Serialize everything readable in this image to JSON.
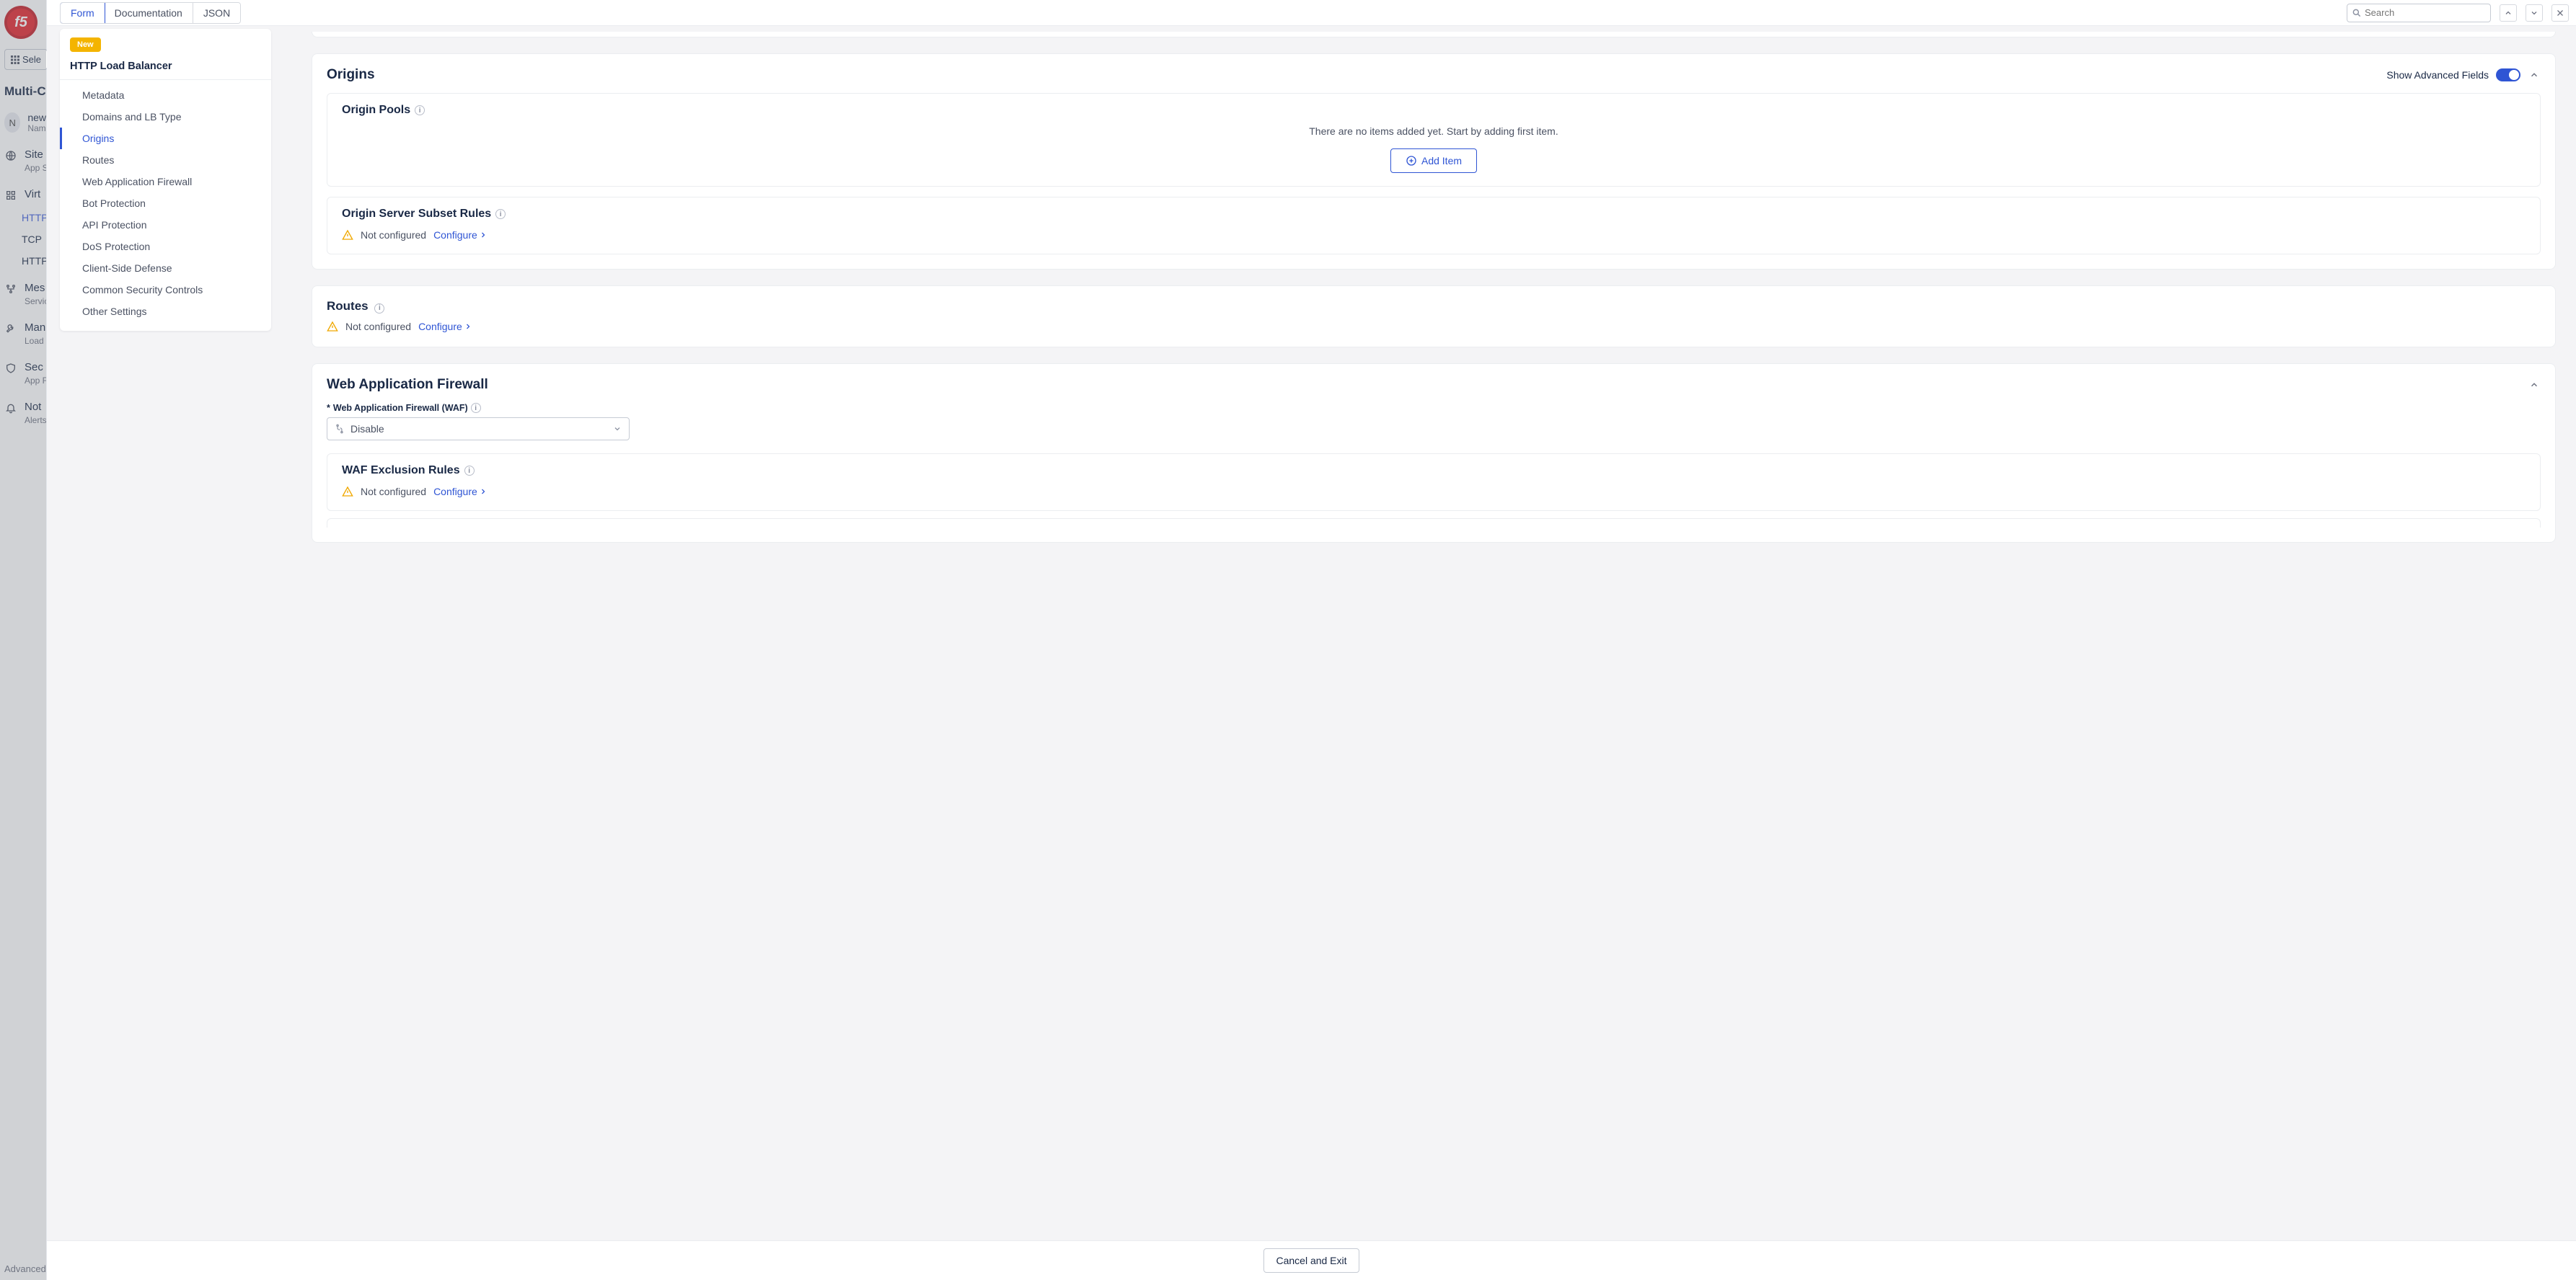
{
  "brand_logo_text": "f5",
  "bg": {
    "select_label": "Sele",
    "title": "Multi-C",
    "avatar_letter": "N",
    "avatar_name": "new",
    "avatar_sub": "Nam",
    "sites": {
      "label": "Site",
      "sub": "App S"
    },
    "virtual": {
      "label": "Virt"
    },
    "sublinks": {
      "http1": "HTTP",
      "tcp": "TCP",
      "http2": "HTTP"
    },
    "mes": {
      "label": "Mes",
      "sub": "Servic"
    },
    "man": {
      "label": "Man",
      "sub": "Load"
    },
    "sec": {
      "label": "Sec",
      "sub": "App F"
    },
    "not": {
      "label": "Not",
      "sub": "Alerts"
    },
    "footer": "Advanced"
  },
  "tabs": {
    "form": "Form",
    "documentation": "Documentation",
    "json": "JSON"
  },
  "search": {
    "placeholder": "Search"
  },
  "nav": {
    "badge": "New",
    "title": "HTTP Load Balancer",
    "items": [
      "Metadata",
      "Domains and LB Type",
      "Origins",
      "Routes",
      "Web Application Firewall",
      "Bot Protection",
      "API Protection",
      "DoS Protection",
      "Client-Side Defense",
      "Common Security Controls",
      "Other Settings"
    ],
    "active_index": 2
  },
  "sections": {
    "origins": {
      "title": "Origins",
      "advanced_label": "Show Advanced Fields",
      "origin_pools": {
        "title": "Origin Pools",
        "empty": "There are no items added yet. Start by adding first item.",
        "add_label": "Add Item"
      },
      "subset_rules": {
        "title": "Origin Server Subset Rules",
        "status": "Not configured",
        "action": "Configure"
      }
    },
    "routes": {
      "title": "Routes",
      "status": "Not configured",
      "action": "Configure"
    },
    "waf": {
      "title": "Web Application Firewall",
      "field_label": "Web Application Firewall (WAF)",
      "field_value": "Disable",
      "exclusion": {
        "title": "WAF Exclusion Rules",
        "status": "Not configured",
        "action": "Configure"
      }
    }
  },
  "footer": {
    "cancel": "Cancel and Exit"
  }
}
